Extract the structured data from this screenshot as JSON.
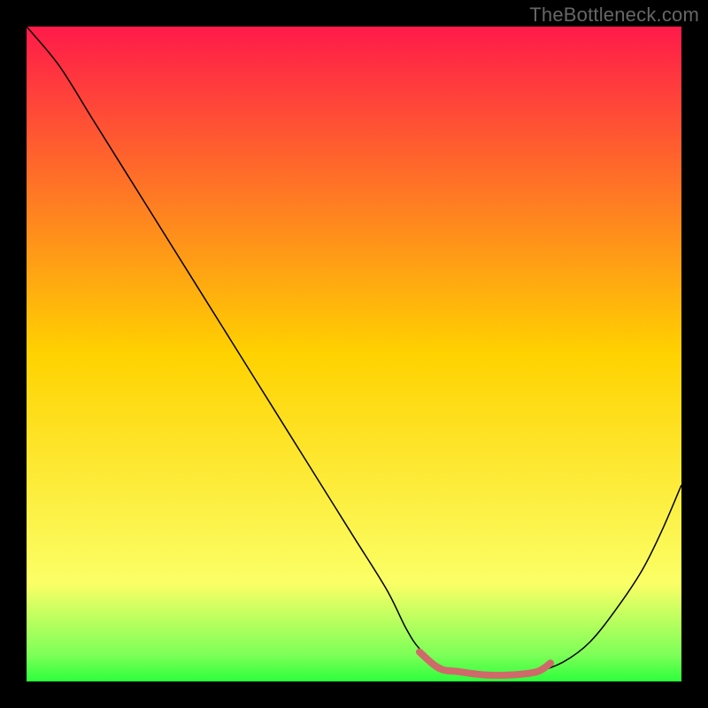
{
  "watermark": "TheBottleneck.com",
  "chart_data": {
    "type": "line",
    "title": "",
    "xlabel": "",
    "ylabel": "",
    "xlim": [
      0,
      100
    ],
    "ylim": [
      0,
      100
    ],
    "background": {
      "type": "vertical-gradient",
      "stops": [
        {
          "offset": 0,
          "color": "#ff1a4a"
        },
        {
          "offset": 50,
          "color": "#ffd200"
        },
        {
          "offset": 85,
          "color": "#fbff66"
        },
        {
          "offset": 96,
          "color": "#7cff58"
        },
        {
          "offset": 100,
          "color": "#2cff3c"
        }
      ]
    },
    "series": [
      {
        "name": "bottleneck-curve",
        "stroke": "#000000",
        "strokeWidth": 1.5,
        "x": [
          0,
          5,
          10,
          15,
          20,
          25,
          30,
          35,
          40,
          45,
          50,
          55,
          58,
          60,
          63,
          66,
          70,
          74,
          78,
          82,
          86,
          90,
          94,
          97,
          100
        ],
        "values": [
          100,
          94,
          86,
          78,
          70,
          62,
          54,
          46,
          38,
          30,
          22,
          14,
          8,
          5,
          2.5,
          1.5,
          1,
          1,
          1.5,
          3,
          6,
          11,
          17,
          23,
          30
        ]
      },
      {
        "name": "optimal-band",
        "stroke": "#cf6a6a",
        "strokeWidth": 8,
        "x": [
          60,
          63,
          66,
          70,
          74,
          78,
          80
        ],
        "values": [
          4.5,
          2,
          1.5,
          1,
          1,
          1.5,
          2.8
        ]
      }
    ]
  }
}
